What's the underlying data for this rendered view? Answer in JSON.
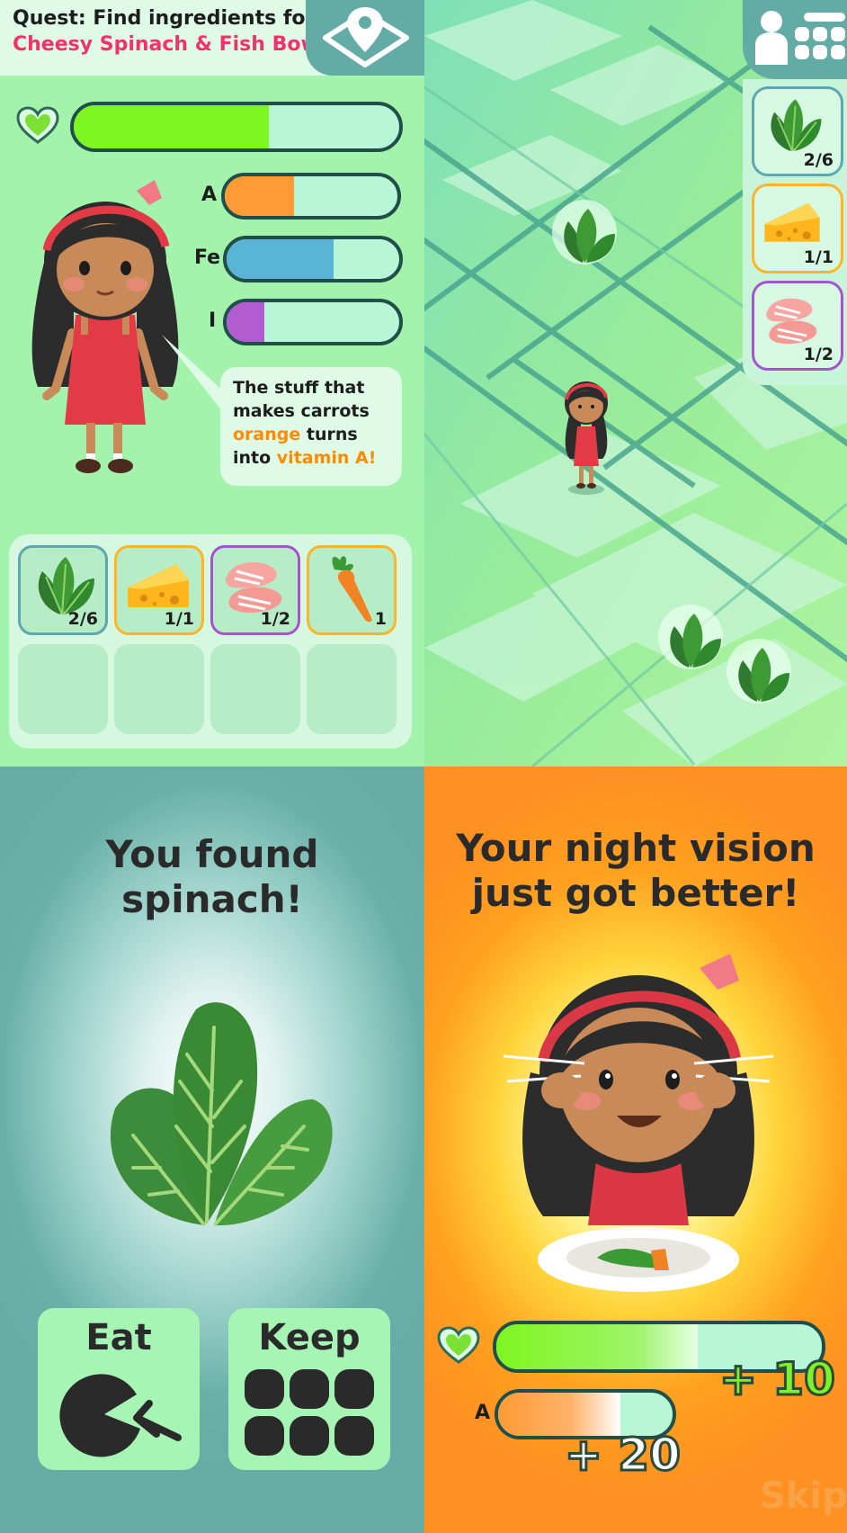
{
  "quest": {
    "prefix": "Quest: Find ingredients for",
    "recipe": "Cheesy Spinach & Fish Bowl"
  },
  "icons": {
    "map": "map-pin-icon",
    "profile": "person-icon",
    "menu": "grid-menu-icon",
    "health": "heart-icon"
  },
  "stats": {
    "health_fill": 0.6,
    "nutrients": [
      {
        "label": "A",
        "fill": 0.4,
        "color": "#ff9a35"
      },
      {
        "label": "Fe",
        "fill": 0.62,
        "color": "#59b4d6"
      },
      {
        "label": "I",
        "fill": 0.22,
        "color": "#b35bd1"
      }
    ]
  },
  "tip": {
    "line1": "The stuff that",
    "line2": "makes carrots",
    "line3_hl": "orange",
    "line3_rest": " turns",
    "line4_pre": "into ",
    "line4_hl": "vitamin A!"
  },
  "inventory": [
    {
      "item": "spinach",
      "count": "2/6",
      "border": "#5ea6b0"
    },
    {
      "item": "cheese",
      "count": "1/1",
      "border": "#ffb328"
    },
    {
      "item": "fish",
      "count": "1/2",
      "border": "#a653cf"
    },
    {
      "item": "carrot",
      "count": "1",
      "border": "#ffb328"
    }
  ],
  "map_sidebar": [
    {
      "item": "spinach",
      "count": "2/6",
      "border": "#5ea6b0"
    },
    {
      "item": "cheese",
      "count": "1/1",
      "border": "#ffb328"
    },
    {
      "item": "fish",
      "count": "1/2",
      "border": "#a653cf"
    }
  ],
  "found": {
    "title_line1": "You found",
    "title_line2": "spinach!",
    "eat_label": "Eat",
    "keep_label": "Keep"
  },
  "result": {
    "title_line1": "Your night vision",
    "title_line2": "just got better!",
    "health_gain": "+ 10",
    "a_label": "A",
    "a_gain": "+ 20",
    "skip": "Skip"
  }
}
